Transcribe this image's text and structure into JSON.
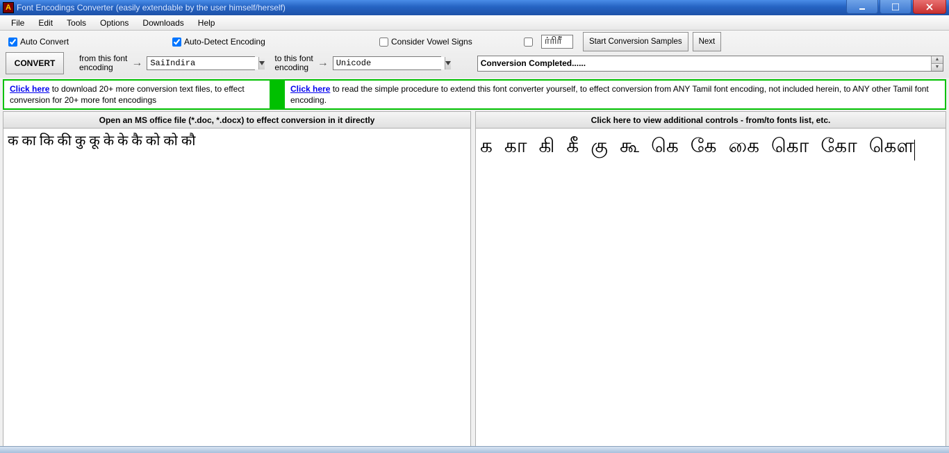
{
  "window": {
    "title": "Font Encodings Converter (easily extendable by the user himself/herself)",
    "icon_letter": "A"
  },
  "menu": {
    "items": [
      "File",
      "Edit",
      "Tools",
      "Options",
      "Downloads",
      "Help"
    ]
  },
  "toolbar": {
    "auto_convert": {
      "label": "Auto Convert",
      "checked": true
    },
    "auto_detect": {
      "label": "Auto-Detect Encoding",
      "checked": true
    },
    "vowel_signs": {
      "label": "Consider Vowel Signs",
      "checked": false
    },
    "small_chk_checked": false,
    "small_sample": "ர்ரிரீ",
    "convert_label": "CONVERT",
    "from_label_1": "from this font",
    "from_label_2": "encoding",
    "to_label_1": "to this font",
    "to_label_2": "encoding",
    "from_encoding": "SaiIndira",
    "to_encoding": "Unicode",
    "samples_btn": "Start Conversion Samples",
    "next_btn": "Next",
    "status": "Conversion Completed......"
  },
  "info": {
    "left_link": "Click here",
    "left_text": " to download 20+ more conversion text files, to effect conversion for 20+ more font encodings",
    "right_link": "Click here",
    "right_text": " to read the simple procedure to extend this font converter yourself, to effect conversion from ANY Tamil font encoding, not included herein, to ANY other Tamil font encoding."
  },
  "panes": {
    "left_header": "Open an MS office file (*.doc, *.docx) to effect conversion in it directly",
    "right_header": "Click here to view additional controls - from/to fonts list, etc.",
    "left_text": "क का कि की कु कू के के कै   को को कौ",
    "right_text": "க கா கி கீ கு கூ கெ கே கை   கொ கோ கௌ"
  }
}
